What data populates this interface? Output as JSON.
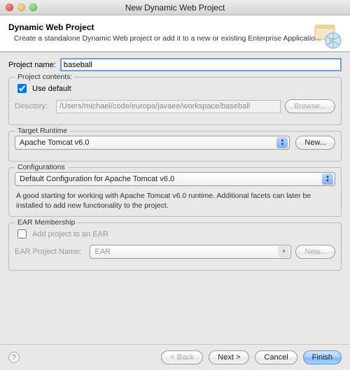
{
  "window": {
    "title": "New Dynamic Web Project"
  },
  "banner": {
    "heading": "Dynamic Web Project",
    "subtext": "Create a standalone Dynamic Web project or add it to a new or existing Enterprise Application."
  },
  "project_name": {
    "label": "Project name:",
    "value": "baseball"
  },
  "contents": {
    "legend": "Project contents:",
    "use_default_label": "Use default",
    "use_default_checked": true,
    "dir_label": "Directory:",
    "dir_value": "/Users/michael/code/europa/javaee/workspace/baseball",
    "browse_label": "Browse..."
  },
  "runtime": {
    "legend": "Target Runtime",
    "value": "Apache Tomcat v6.0",
    "new_label": "New..."
  },
  "config": {
    "legend": "Configurations",
    "value": "Default Configuration for Apache Tomcat v6.0",
    "desc": "A good starting for working with Apache Tomcat v6.0 runtime. Additional facets can later be installed to add new functionality to the project."
  },
  "ear": {
    "legend": "EAR Membership",
    "add_label": "Add project to an EAR",
    "add_checked": false,
    "proj_label": "EAR Project Name:",
    "proj_value": "EAR",
    "new_label": "New..."
  },
  "footer": {
    "back": "< Back",
    "next": "Next >",
    "cancel": "Cancel",
    "finish": "Finish"
  }
}
